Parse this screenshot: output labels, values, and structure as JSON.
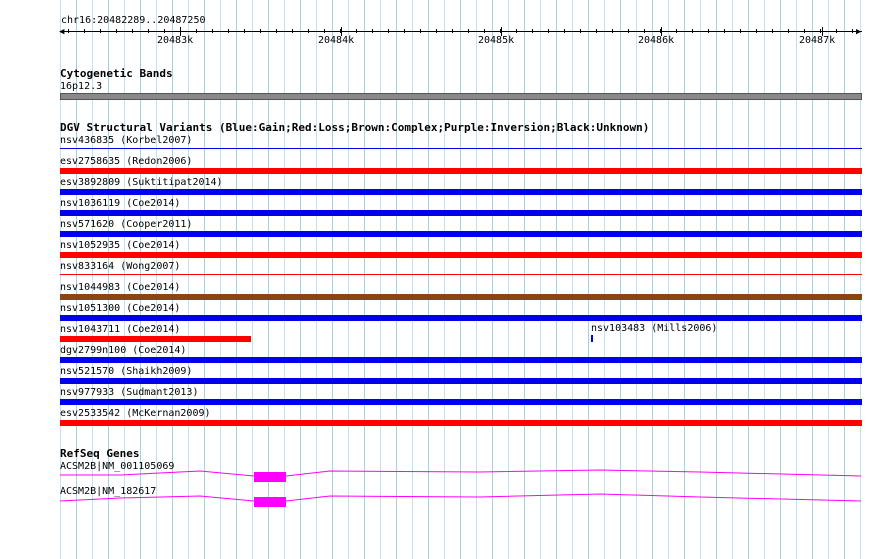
{
  "locus": "chr16:20482289..20487250",
  "ruler": {
    "start": 20482289,
    "end": 20487250,
    "labels": [
      "20483k",
      "20484k",
      "20485k",
      "20486k",
      "20487k"
    ]
  },
  "cytoband": {
    "title": "Cytogenetic Bands",
    "band": "16p12.3",
    "color": "#888888"
  },
  "dgv": {
    "title": "DGV Structural Variants (Blue:Gain;Red:Loss;Brown:Complex;Purple:Inversion;Black:Unknown)",
    "colors": {
      "gain": "#0000ee",
      "loss": "#ff0000",
      "complex": "#8b4513",
      "unknown": "#000000"
    },
    "tracks": [
      {
        "label": "nsv436835 (Korbel2007)",
        "type": "gain",
        "thin": true
      },
      {
        "label": "esv2758635 (Redon2006)",
        "type": "loss"
      },
      {
        "label": "esv3892809 (Suktitipat2014)",
        "type": "gain"
      },
      {
        "label": "nsv1036119 (Coe2014)",
        "type": "gain"
      },
      {
        "label": "nsv571620 (Cooper2011)",
        "type": "gain"
      },
      {
        "label": "nsv1052935 (Coe2014)",
        "type": "loss"
      },
      {
        "label": "nsv833164 (Wong2007)",
        "type": "loss",
        "thin": true
      },
      {
        "label": "nsv1044983 (Coe2014)",
        "type": "complex"
      },
      {
        "label": "nsv1051300 (Coe2014)",
        "type": "gain"
      },
      {
        "label": "nsv1043711 (Coe2014)",
        "type": "loss",
        "partial": true
      },
      {
        "label": "dgv2799n100 (Coe2014)",
        "type": "gain"
      },
      {
        "label": "nsv521570 (Shaikh2009)",
        "type": "gain"
      },
      {
        "label": "nsv977933 (Sudmant2013)",
        "type": "gain"
      },
      {
        "label": "esv2533542 (McKernan2009)",
        "type": "loss"
      }
    ],
    "extra": {
      "label": "nsv103483 (Mills2006)",
      "type": "gain"
    }
  },
  "refseq": {
    "title": "RefSeq Genes",
    "color": "#ff00ff",
    "genes": [
      {
        "label": "ACSM2B|NM_001105069"
      },
      {
        "label": "ACSM2B|NM_182617"
      }
    ]
  }
}
